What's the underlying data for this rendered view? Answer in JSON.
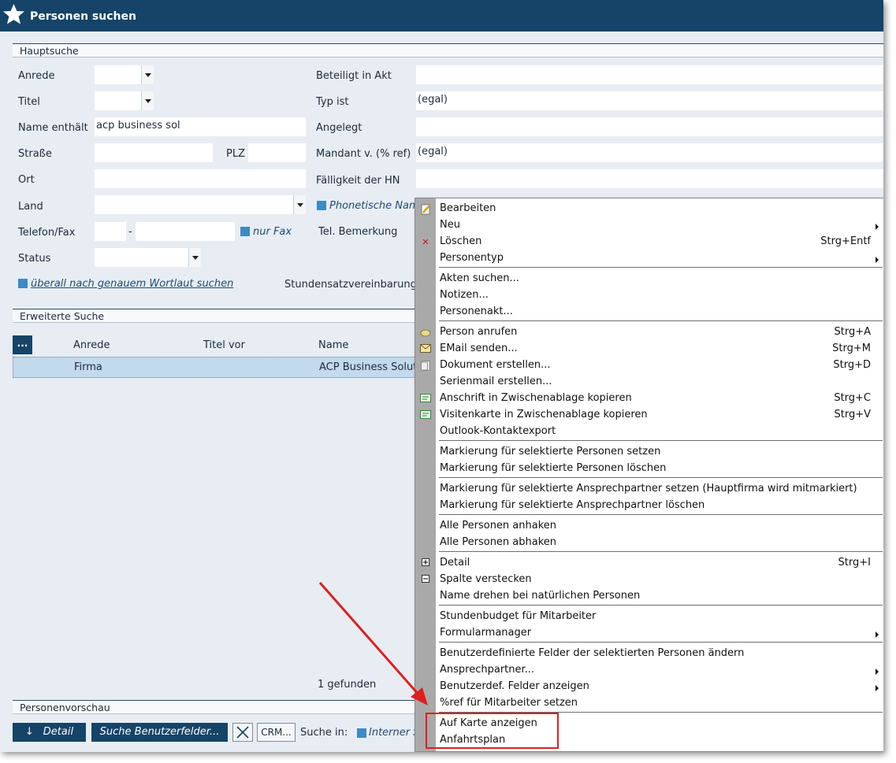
{
  "window": {
    "title": "Personen suchen"
  },
  "sections": {
    "main": "Hauptsuche",
    "extended": "Erweiterte Suche",
    "preview": "Personenvorschau"
  },
  "form": {
    "anrede_label": "Anrede",
    "titel_label": "Titel",
    "name_label": "Name enthält",
    "name_value": "acp business sol",
    "strasse_label": "Straße",
    "plz_label": "PLZ",
    "ort_label": "Ort",
    "land_label": "Land",
    "telefon_label": "Telefon/Fax",
    "telefon_sep": "-",
    "nur_fax": "nur Fax",
    "status_label": "Status",
    "wortlaut": "überall nach genauem Wortlaut suchen",
    "beteiligt_label": "Beteiligt in Akt",
    "typ_label": "Typ ist",
    "typ_value": "(egal)",
    "angelegt_label": "Angelegt",
    "mandant_label": "Mandant v. (% ref)",
    "mandant_value": "(egal)",
    "faelligkeit_label": "Fälligkeit der HN",
    "phonetisch": "Phonetische Nam",
    "tel_bemerkung": "Tel. Bemerkung",
    "stundensatz": "Stundensatzvereinbarung v"
  },
  "grid": {
    "more_button": "...",
    "columns": [
      "Anrede",
      "Titel vor",
      "Name"
    ],
    "rows": [
      {
        "anrede": "Firma",
        "titel": "",
        "name": "ACP Business Solutio"
      }
    ],
    "found": "1 gefunden"
  },
  "toolbar": {
    "detail": "Detail",
    "benutzerfelder": "Suche Benutzerfelder...",
    "crm": "CRM...",
    "suche_in": "Suche in:",
    "interner": "Interner S"
  },
  "menu": {
    "items": [
      {
        "label": "Bearbeiten",
        "shortcut": "",
        "submenu": false,
        "icon": "pencil-icon"
      },
      {
        "label": "Neu",
        "shortcut": "",
        "submenu": true,
        "icon": ""
      },
      {
        "label": "Löschen",
        "shortcut": "Strg+Entf",
        "submenu": false,
        "icon": "delete-x-icon"
      },
      {
        "label": "Personentyp",
        "shortcut": "",
        "submenu": true,
        "icon": ""
      },
      {
        "label": "Akten suchen...",
        "shortcut": "",
        "submenu": false,
        "icon": ""
      },
      {
        "label": "Notizen...",
        "shortcut": "",
        "submenu": false,
        "icon": ""
      },
      {
        "label": "Personenakt...",
        "shortcut": "",
        "submenu": false,
        "icon": ""
      },
      {
        "label": "Person anrufen",
        "shortcut": "Strg+A",
        "submenu": false,
        "icon": "phone-icon"
      },
      {
        "label": "EMail senden...",
        "shortcut": "Strg+M",
        "submenu": false,
        "icon": "envelope-icon"
      },
      {
        "label": "Dokument erstellen...",
        "shortcut": "Strg+D",
        "submenu": false,
        "icon": "document-icon"
      },
      {
        "label": "Serienmail erstellen...",
        "shortcut": "",
        "submenu": false,
        "icon": ""
      },
      {
        "label": "Anschrift in Zwischenablage kopieren",
        "shortcut": "Strg+C",
        "submenu": false,
        "icon": "address-card-icon"
      },
      {
        "label": "Visitenkarte in Zwischenablage kopieren",
        "shortcut": "Strg+V",
        "submenu": false,
        "icon": "business-card-icon"
      },
      {
        "label": "Outlook-Kontaktexport",
        "shortcut": "",
        "submenu": false,
        "icon": ""
      },
      {
        "label": "Markierung für selektierte Personen setzen",
        "shortcut": "",
        "submenu": false,
        "icon": ""
      },
      {
        "label": "Markierung für selektierte Personen löschen",
        "shortcut": "",
        "submenu": false,
        "icon": ""
      },
      {
        "label": "Markierung für selektierte Ansprechpartner setzen (Hauptfirma wird mitmarkiert)",
        "shortcut": "",
        "submenu": false,
        "icon": ""
      },
      {
        "label": "Markierung für selektierte Ansprechpartner löschen",
        "shortcut": "",
        "submenu": false,
        "icon": ""
      },
      {
        "label": "Alle Personen anhaken",
        "shortcut": "",
        "submenu": false,
        "icon": ""
      },
      {
        "label": "Alle Personen abhaken",
        "shortcut": "",
        "submenu": false,
        "icon": ""
      },
      {
        "label": "Detail",
        "shortcut": "Strg+I",
        "submenu": false,
        "icon": "plus-box-icon"
      },
      {
        "label": "Spalte verstecken",
        "shortcut": "",
        "submenu": false,
        "icon": "minus-box-icon"
      },
      {
        "label": "Name drehen bei natürlichen Personen",
        "shortcut": "",
        "submenu": false,
        "icon": ""
      },
      {
        "label": "Stundenbudget für Mitarbeiter",
        "shortcut": "",
        "submenu": false,
        "icon": ""
      },
      {
        "label": "Formularmanager",
        "shortcut": "",
        "submenu": true,
        "icon": ""
      },
      {
        "label": "Benutzerdefinierte Felder der selektierten Personen ändern",
        "shortcut": "",
        "submenu": false,
        "icon": ""
      },
      {
        "label": "Ansprechpartner...",
        "shortcut": "",
        "submenu": true,
        "icon": ""
      },
      {
        "label": "Benutzerdef. Felder anzeigen",
        "shortcut": "",
        "submenu": true,
        "icon": ""
      },
      {
        "label": "%ref für Mitarbeiter setzen",
        "shortcut": "",
        "submenu": false,
        "icon": ""
      },
      {
        "label": "Auf Karte anzeigen",
        "shortcut": "",
        "submenu": false,
        "icon": ""
      },
      {
        "label": "Anfahrtsplan",
        "shortcut": "",
        "submenu": false,
        "icon": ""
      }
    ]
  },
  "colors": {
    "accent": "#154468",
    "background": "#e7edf3",
    "highlight": "#e01e1e",
    "checkbox": "#3d8ac4"
  }
}
